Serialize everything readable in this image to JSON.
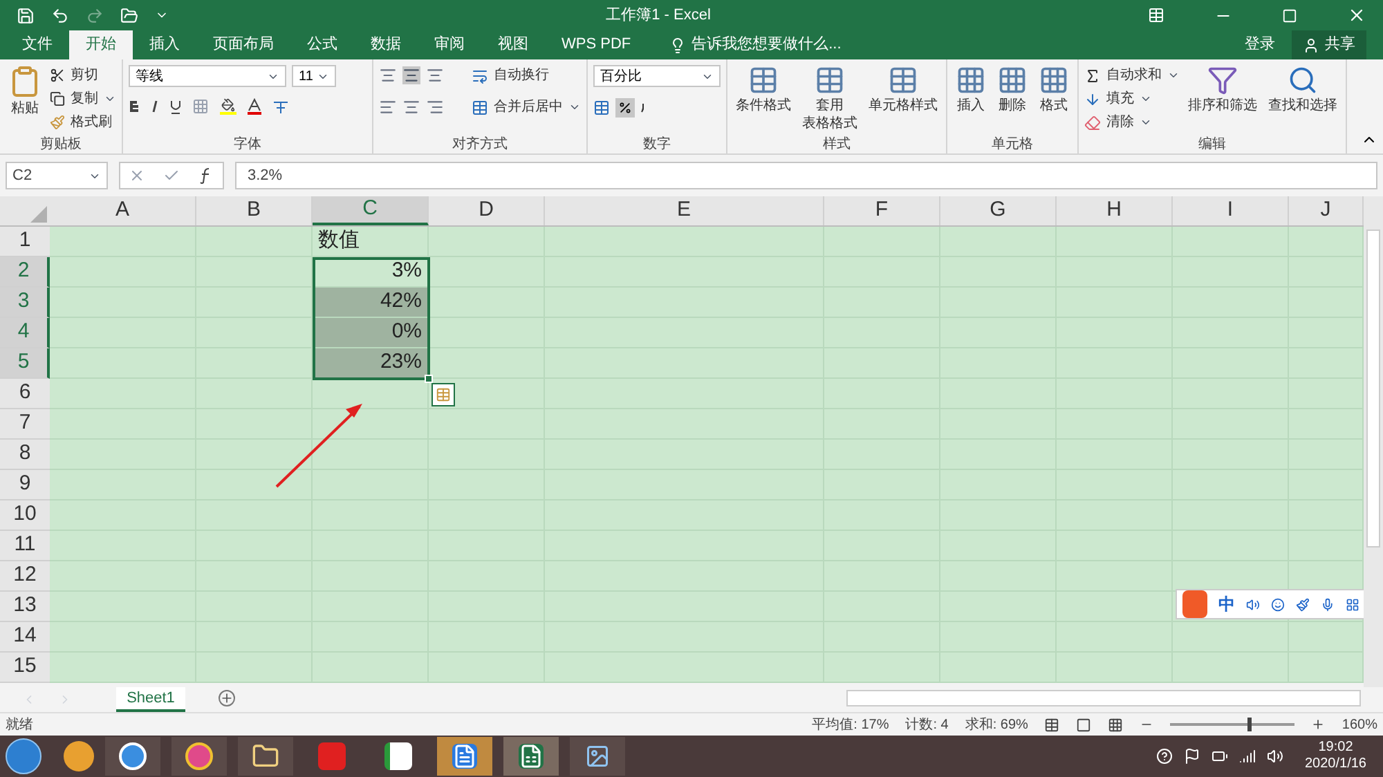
{
  "window": {
    "title": "工作簿1 - Excel"
  },
  "tabs": [
    {
      "label": "文件",
      "selected": false
    },
    {
      "label": "开始",
      "selected": true
    },
    {
      "label": "插入",
      "selected": false
    },
    {
      "label": "页面布局",
      "selected": false
    },
    {
      "label": "公式",
      "selected": false
    },
    {
      "label": "数据",
      "selected": false
    },
    {
      "label": "审阅",
      "selected": false
    },
    {
      "label": "视图",
      "selected": false
    },
    {
      "label": "WPS PDF",
      "selected": false
    }
  ],
  "tell_me": "告诉我您想要做什么...",
  "account": {
    "login": "登录",
    "share": "共享"
  },
  "ribbon": {
    "clipboard": {
      "label": "剪贴板",
      "paste": "粘贴",
      "cut": "剪切",
      "copy": "复制",
      "format_painter": "格式刷"
    },
    "font": {
      "label": "字体",
      "font_name": "等线",
      "font_size": "11"
    },
    "alignment": {
      "label": "对齐方式",
      "wrap": "自动换行",
      "merge": "合并后居中"
    },
    "number": {
      "label": "数字",
      "format": "百分比",
      "percent_selected": true
    },
    "styles": {
      "label": "样式",
      "buttons": [
        {
          "lines": [
            "条件格式"
          ]
        },
        {
          "lines": [
            "套用",
            "表格格式"
          ]
        },
        {
          "lines": [
            "单元格样式"
          ]
        }
      ]
    },
    "cells": {
      "label": "单元格",
      "buttons": [
        {
          "lines": [
            "插入"
          ]
        },
        {
          "lines": [
            "删除"
          ]
        },
        {
          "lines": [
            "格式"
          ]
        }
      ]
    },
    "editing": {
      "label": "编辑",
      "autosum": "自动求和",
      "fill": "填充",
      "clear": "清除",
      "sort": "排序和筛选",
      "find": "查找和选择"
    }
  },
  "formula_bar": {
    "name_box": "C2",
    "formula": "3.2%"
  },
  "columns": [
    {
      "label": "A",
      "selected": false
    },
    {
      "label": "B",
      "selected": false
    },
    {
      "label": "C",
      "selected": true
    },
    {
      "label": "D",
      "selected": false
    },
    {
      "label": "E",
      "selected": false
    },
    {
      "label": "F",
      "selected": false
    },
    {
      "label": "G",
      "selected": false
    },
    {
      "label": "H",
      "selected": false
    },
    {
      "label": "I",
      "selected": false
    },
    {
      "label": "J",
      "selected": false
    }
  ],
  "rows": [
    {
      "label": "1",
      "selected": false,
      "cells": {
        "C": {
          "text": "数值",
          "kind": "text",
          "selected": false
        }
      }
    },
    {
      "label": "2",
      "selected": true,
      "cells": {
        "C": {
          "text": "3%",
          "kind": "number",
          "selected": false
        }
      }
    },
    {
      "label": "3",
      "selected": true,
      "cells": {
        "C": {
          "text": "42%",
          "kind": "number",
          "selected": true
        }
      }
    },
    {
      "label": "4",
      "selected": true,
      "cells": {
        "C": {
          "text": "0%",
          "kind": "number",
          "selected": true
        }
      }
    },
    {
      "label": "5",
      "selected": true,
      "cells": {
        "C": {
          "text": "23%",
          "kind": "number",
          "selected": true
        }
      }
    },
    {
      "label": "6",
      "selected": false,
      "cells": {}
    },
    {
      "label": "7",
      "selected": false,
      "cells": {}
    },
    {
      "label": "8",
      "selected": false,
      "cells": {}
    },
    {
      "label": "9",
      "selected": false,
      "cells": {}
    },
    {
      "label": "10",
      "selected": false,
      "cells": {}
    },
    {
      "label": "11",
      "selected": false,
      "cells": {}
    },
    {
      "label": "12",
      "selected": false,
      "cells": {}
    },
    {
      "label": "13",
      "selected": false,
      "cells": {}
    },
    {
      "label": "14",
      "selected": false,
      "cells": {}
    },
    {
      "label": "15",
      "selected": false,
      "cells": {}
    }
  ],
  "ime_toolbar": {
    "mode": "中"
  },
  "sheets": [
    {
      "label": "Sheet1",
      "selected": true
    }
  ],
  "status_bar": {
    "state": "就绪",
    "average": "平均值: 17%",
    "count": "计数: 4",
    "sum": "求和: 69%",
    "zoom": "160%",
    "zoom_level": {
      "level": 0.62
    }
  },
  "taskbar": {
    "time": "19:02",
    "date": "2020/1/16"
  }
}
